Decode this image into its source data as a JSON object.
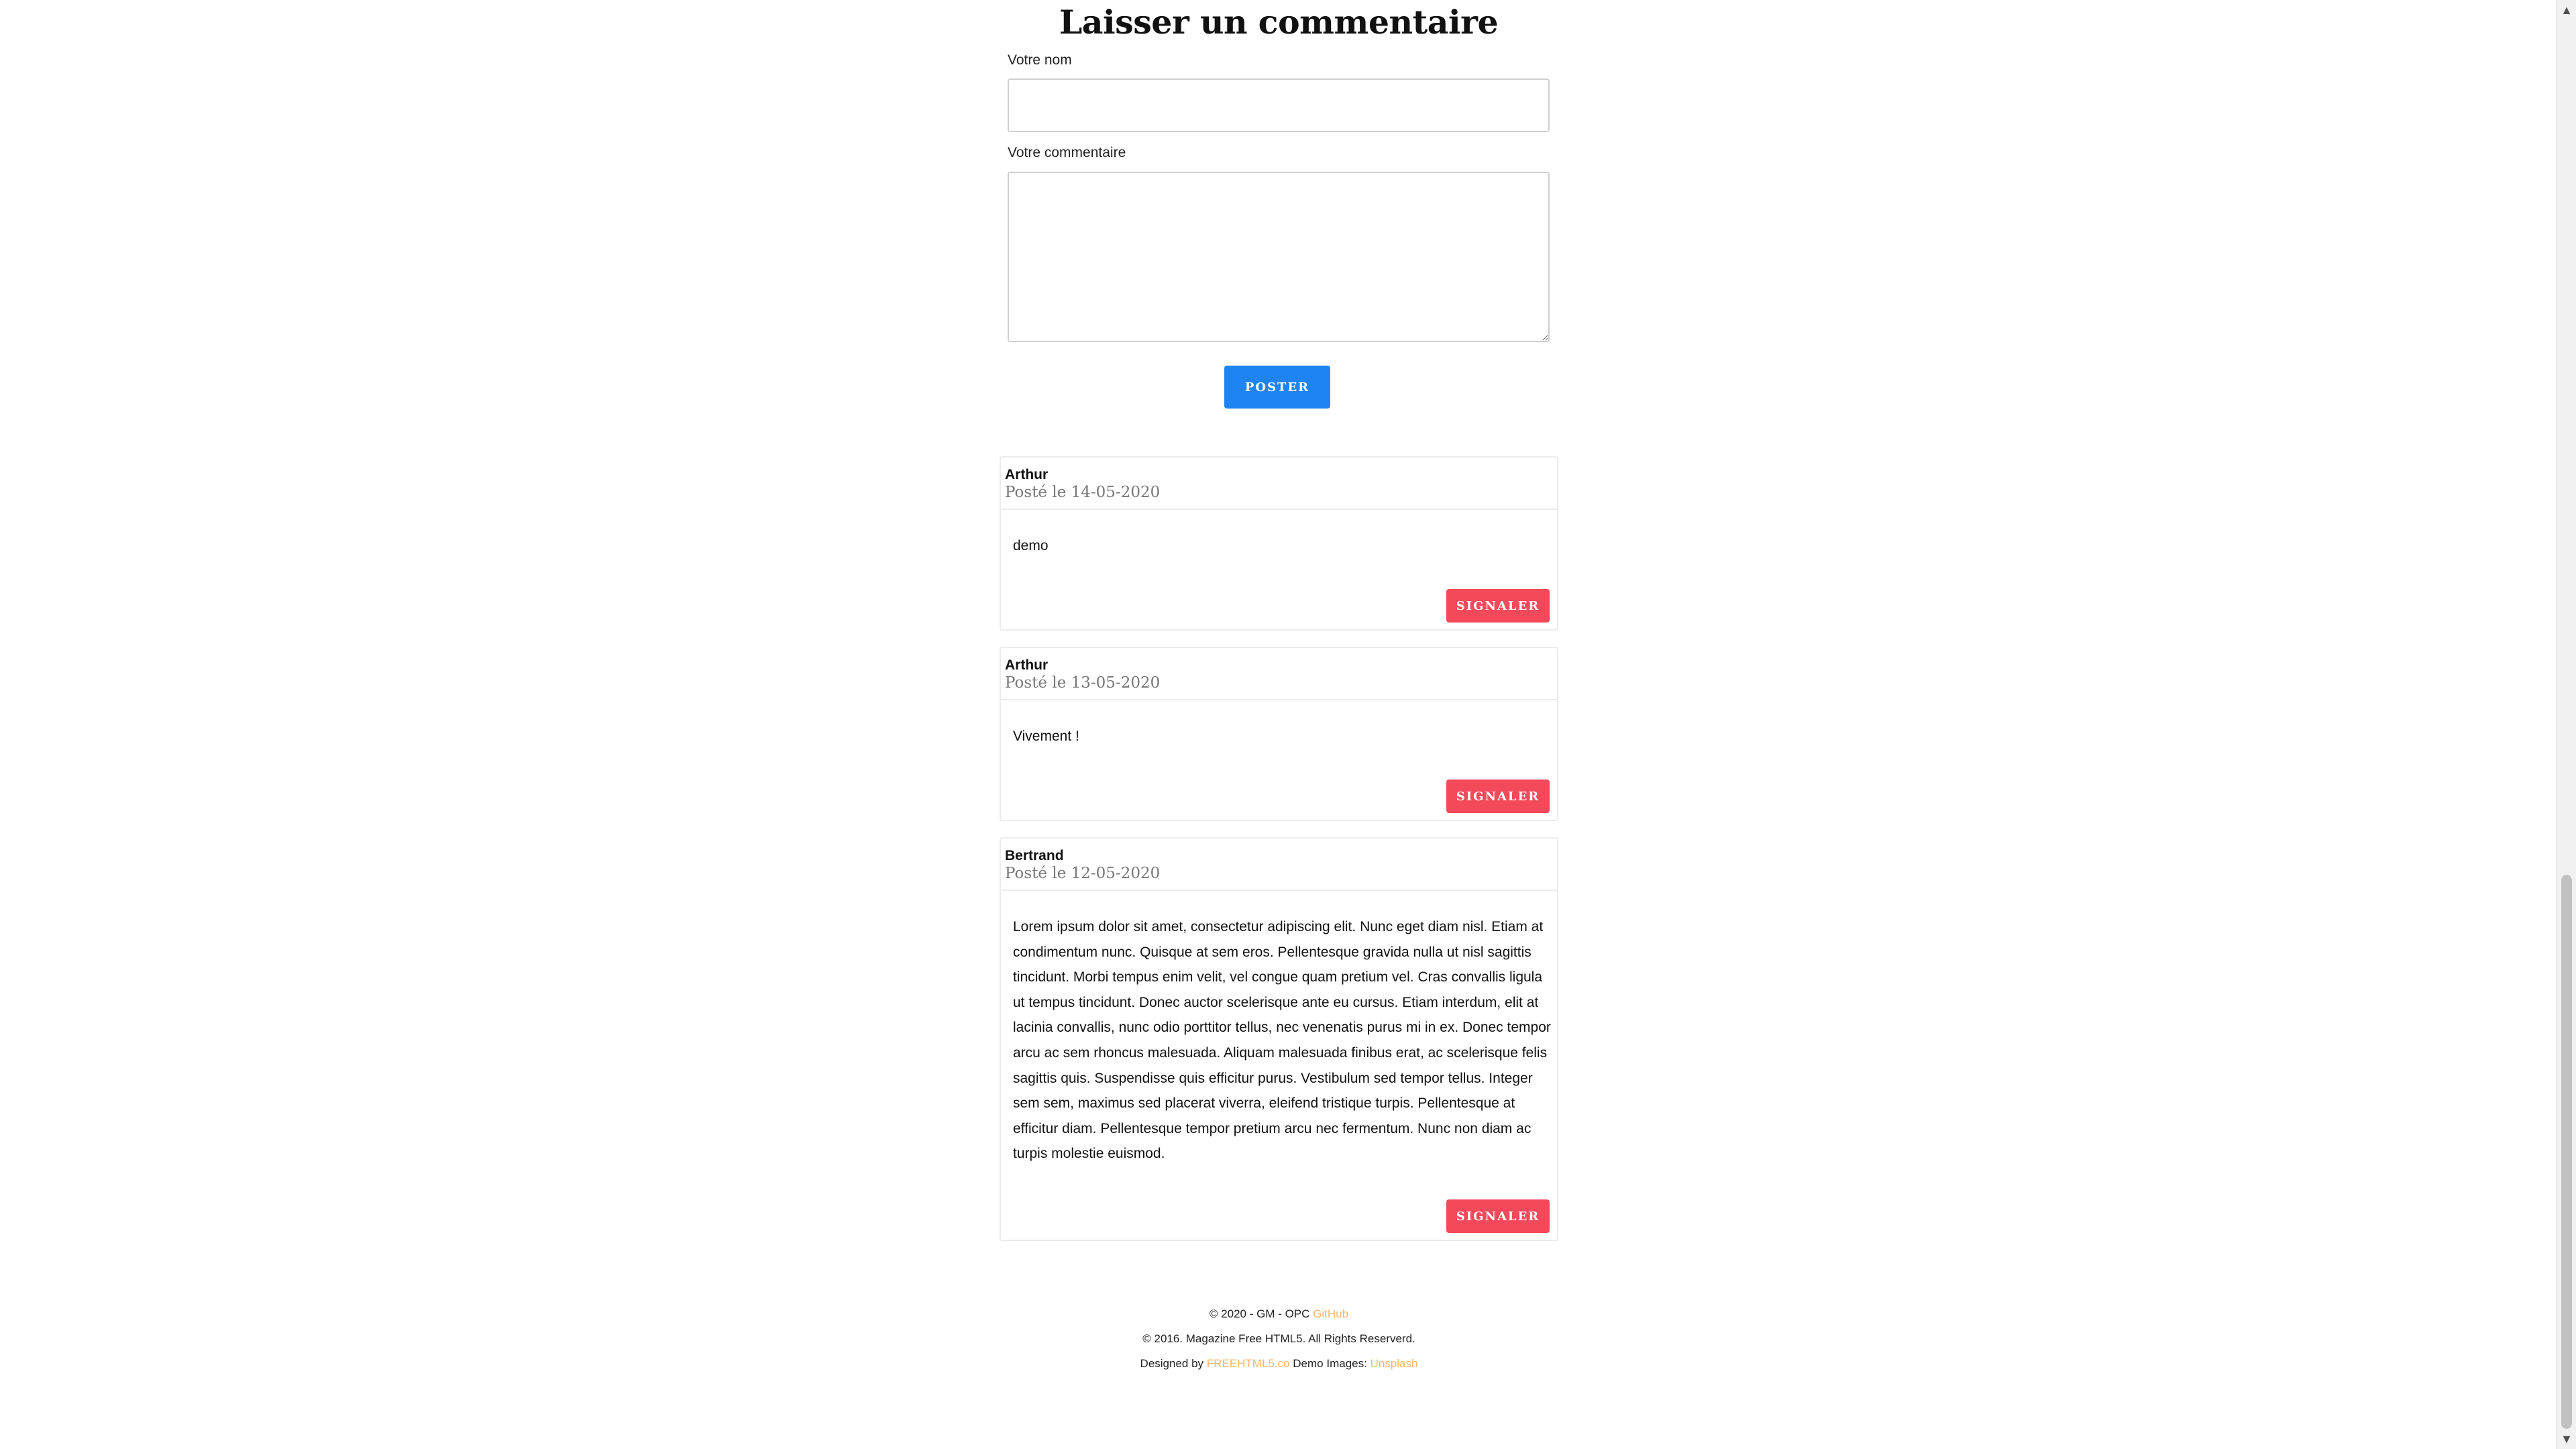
{
  "form": {
    "title": "Laisser un commentaire",
    "name_label": "Votre nom",
    "name_value": "",
    "comment_label": "Votre commentaire",
    "comment_value": "",
    "submit_label": "POSTER"
  },
  "comments": [
    {
      "author": "Arthur",
      "date": "Posté le 14-05-2020",
      "text": "demo",
      "report_label": "SIGNALER"
    },
    {
      "author": "Arthur",
      "date": "Posté le 13-05-2020",
      "text": "Vivement !",
      "report_label": "SIGNALER"
    },
    {
      "author": "Bertrand",
      "date": "Posté le 12-05-2020",
      "text": "Lorem ipsum dolor sit amet, consectetur adipiscing elit. Nunc eget diam nisl. Etiam at condimentum nunc. Quisque at sem eros. Pellentesque gravida nulla ut nisl sagittis tincidunt. Morbi tempus enim velit, vel congue quam pretium vel. Cras convallis ligula ut tempus tincidunt. Donec auctor scelerisque ante eu cursus. Etiam interdum, elit at lacinia convallis, nunc odio porttitor tellus, nec venenatis purus mi in ex. Donec tempor arcu ac sem rhoncus malesuada. Aliquam malesuada finibus erat, ac scelerisque felis sagittis quis. Suspendisse quis efficitur purus. Vestibulum sed tempor tellus. Integer sem sem, maximus sed placerat viverra, eleifend tristique turpis. Pellentesque at efficitur diam. Pellentesque tempor pretium arcu nec fermentum. Nunc non diam ac turpis molestie euismod.",
      "report_label": "SIGNALER"
    }
  ],
  "footer": {
    "line1_text": "© 2020 - GM - OPC",
    "line1_link": "GitHub",
    "line2_text": "© 2016. Magazine Free HTML5. All Rights Reserverd.",
    "line3_designed": "Designed by",
    "line3_designer_link": "FREEHTML5.co",
    "line3_demo": "Demo Images:",
    "line3_images_link": "Unsplash"
  },
  "colors": {
    "primary_button": "#1f84f3",
    "report_button": "#f4495a",
    "footer_link": "#f5b66c"
  }
}
